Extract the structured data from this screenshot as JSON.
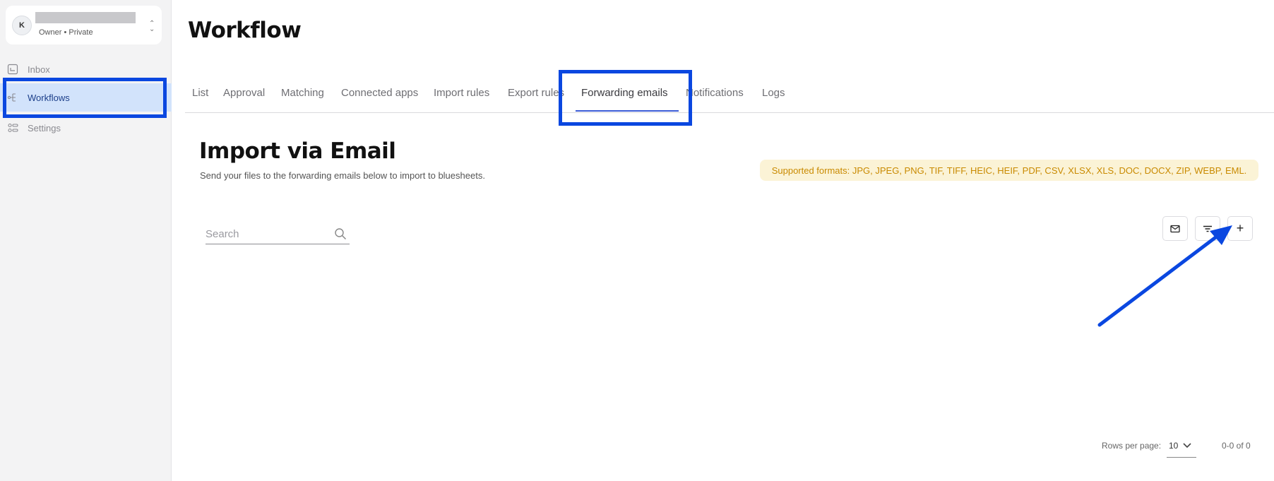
{
  "workspace": {
    "avatar_letter": "K",
    "name": "",
    "meta": "Owner • Private"
  },
  "sidebar": {
    "items": [
      {
        "label": "Inbox",
        "icon": "inbox-icon"
      },
      {
        "label": "Workflows",
        "icon": "workflow-icon",
        "active": true
      },
      {
        "label": "Settings",
        "icon": "settings-icon"
      }
    ]
  },
  "page": {
    "title": "Workflow"
  },
  "tabs": [
    {
      "label": "List"
    },
    {
      "label": "Approval"
    },
    {
      "label": "Matching"
    },
    {
      "label": "Connected apps"
    },
    {
      "label": "Import rules"
    },
    {
      "label": "Export rules"
    },
    {
      "label": "Forwarding emails",
      "active": true
    },
    {
      "label": "Notifications"
    },
    {
      "label": "Logs"
    }
  ],
  "section": {
    "title": "Import via Email",
    "subtitle": "Send your files to the forwarding emails below to import to bluesheets.",
    "formats": "Supported formats: JPG, JPEG, PNG, TIF, TIFF, HEIC, HEIF, PDF, CSV, XLSX, XLS, DOC, DOCX, ZIP, WEBP, EML."
  },
  "search": {
    "placeholder": "Search",
    "value": ""
  },
  "toolbar": {
    "email_icon": "mail-icon",
    "filter_icon": "filter-icon",
    "add_label": "+"
  },
  "pagination": {
    "rows_label": "Rows per page:",
    "rows_value": "10",
    "range": "0-0 of  0"
  },
  "colors": {
    "highlight": "#0a47e0",
    "active_nav_bg": "#d2e3fb",
    "formats_bg": "#fbf3d6",
    "formats_text": "#c98a00"
  }
}
